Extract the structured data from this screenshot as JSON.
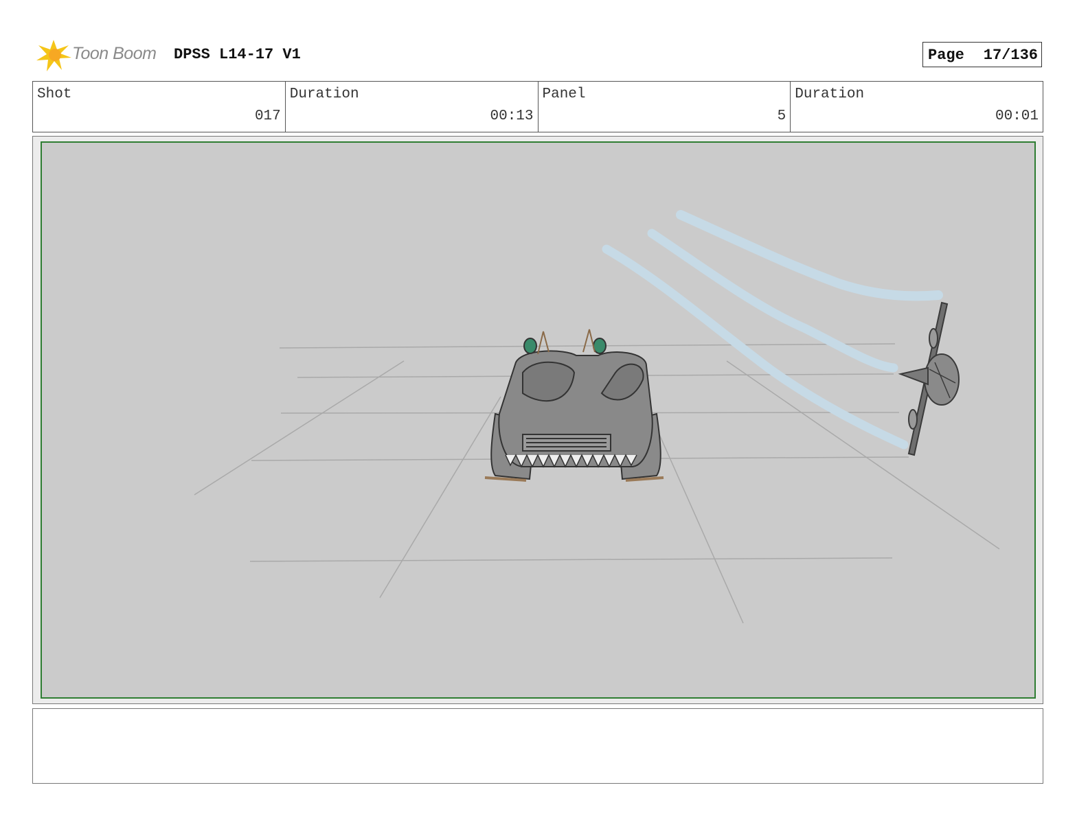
{
  "header": {
    "logo_text": "Toon Boom",
    "logo_icon": "starburst-logo-icon",
    "project_title": "DPSS L14-17 V1",
    "page_label": "Page",
    "page_value": "17/136"
  },
  "info": {
    "shot_label": "Shot",
    "shot_value": "017",
    "shot_duration_label": "Duration",
    "shot_duration_value": "00:13",
    "panel_label": "Panel",
    "panel_value": "5",
    "panel_duration_label": "Duration",
    "panel_duration_value": "00:01"
  },
  "panel": {
    "frame_color": "#2e7d32",
    "background_color": "#cbcbcb",
    "icons": [
      "monster-car-sketch",
      "propeller-plane-sketch",
      "smoke-trail-sketch",
      "perspective-grid-sketch"
    ]
  },
  "notes": {
    "text": ""
  }
}
